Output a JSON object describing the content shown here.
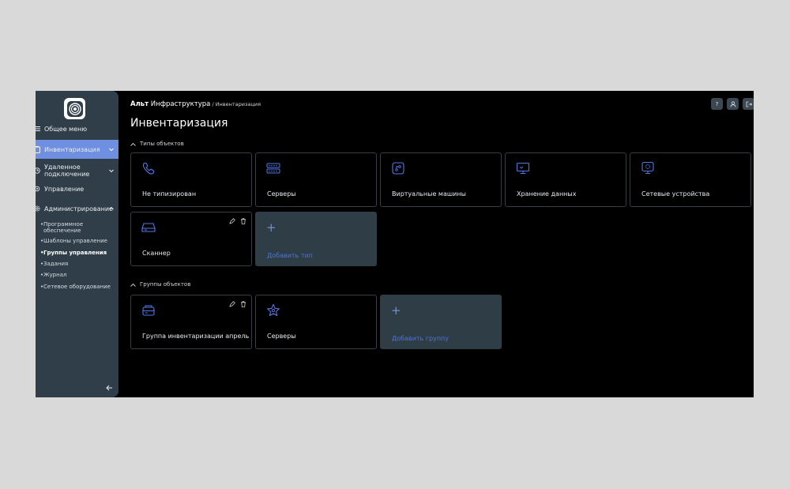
{
  "header": {
    "brand_bold": "Альт",
    "brand_rest": " Инфраструктура",
    "breadcrumb_sep": " / Инвентаризация",
    "title": "Инвентаризация",
    "help_label": "?"
  },
  "sidebar": {
    "items": [
      {
        "label": "Общее меню"
      },
      {
        "label": "Инвентаризация"
      },
      {
        "label": "Удаленное подключение"
      },
      {
        "label": "Управление"
      },
      {
        "label": "Администрирование"
      }
    ],
    "subitems": [
      {
        "label": "Программное обеспечение"
      },
      {
        "label": "Шаблоны управление"
      },
      {
        "label": "Группы управления"
      },
      {
        "label": "Задания"
      },
      {
        "label": "Журнал"
      },
      {
        "label": "Сетевое оборудование"
      }
    ]
  },
  "object_types": {
    "heading": "Типы объектов",
    "cards": [
      {
        "label": "Не типизирован",
        "icon": "phone-icon"
      },
      {
        "label": "Серверы",
        "icon": "server-rack-icon"
      },
      {
        "label": "Виртуальные машины",
        "icon": "vm-icon"
      },
      {
        "label": "Хранение данных",
        "icon": "monitor-icon"
      },
      {
        "label": "Сетевые устройства",
        "icon": "network-device-icon"
      },
      {
        "label": "Сканнер",
        "icon": "scanner-icon"
      }
    ],
    "add_label": "Добавить тип"
  },
  "object_groups": {
    "heading": "Группы объектов",
    "cards": [
      {
        "label": "Группа инвентаризации апрель",
        "icon": "inventory-group-icon"
      },
      {
        "label": "Серверы",
        "icon": "star-icon"
      }
    ],
    "add_label": "Добавить группу"
  },
  "colors": {
    "accent": "#6f8fe0",
    "icon_blue": "#5478e8",
    "sidebar_bg": "#2f3e48",
    "card_border": "#353e45"
  }
}
